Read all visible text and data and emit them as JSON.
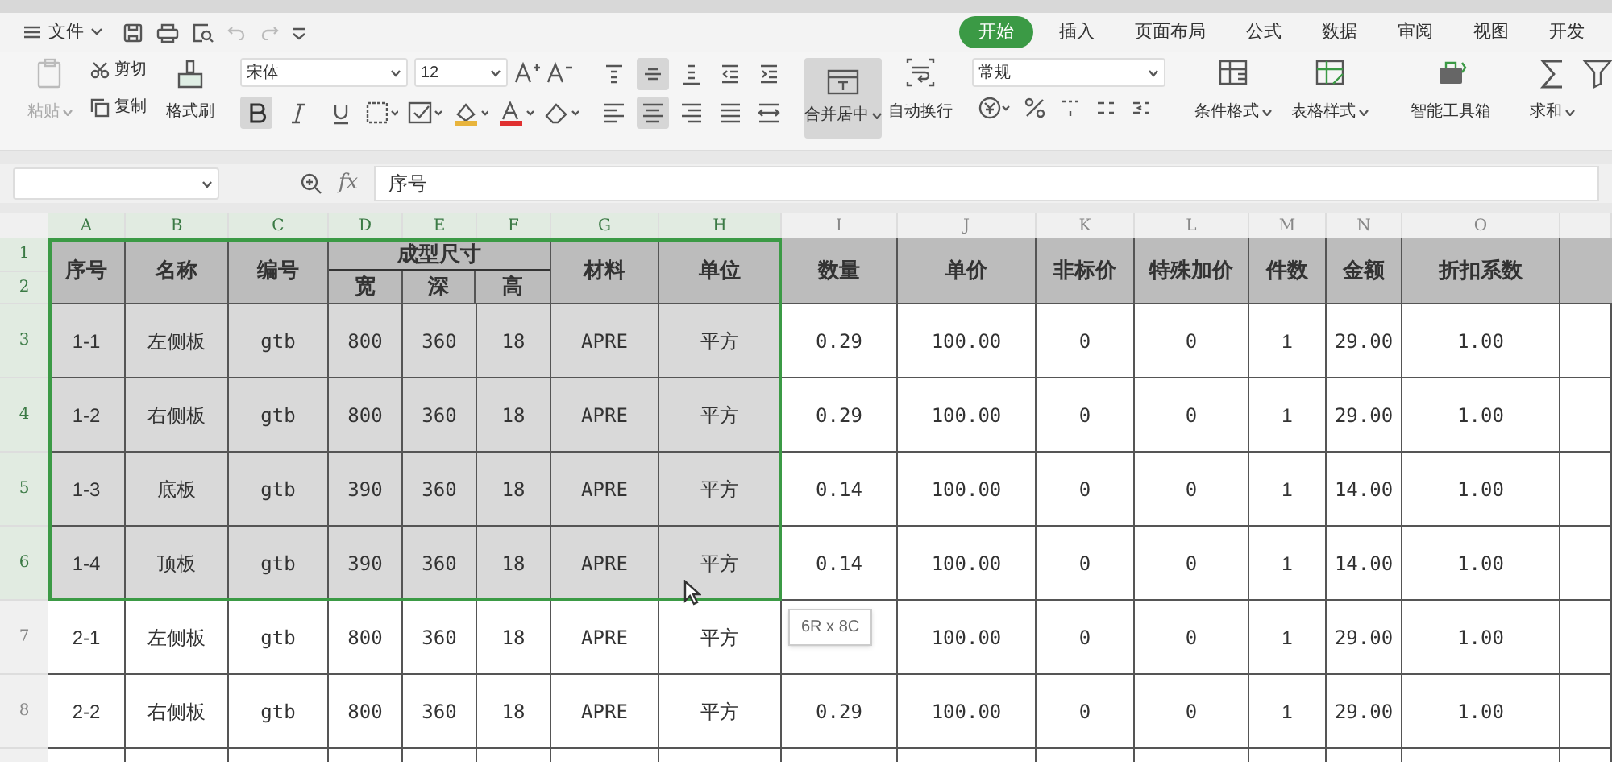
{
  "menu": {
    "label": "文件"
  },
  "ribbon_tabs": [
    {
      "label": "开始",
      "selected": true
    },
    {
      "label": "插入",
      "selected": false
    },
    {
      "label": "页面布局",
      "selected": false
    },
    {
      "label": "公式",
      "selected": false
    },
    {
      "label": "数据",
      "selected": false
    },
    {
      "label": "审阅",
      "selected": false
    },
    {
      "label": "视图",
      "selected": false
    },
    {
      "label": "开发",
      "selected": false
    }
  ],
  "clipboard": {
    "paste": "粘贴",
    "cut": "剪切",
    "copy": "复制",
    "format_painter": "格式刷"
  },
  "font": {
    "family": "宋体",
    "size": "12"
  },
  "font_toggles": [
    {
      "kind": "bold",
      "on": true
    },
    {
      "kind": "italic",
      "on": false
    },
    {
      "kind": "underline",
      "on": false
    }
  ],
  "align_top": [
    {
      "kind": "top",
      "on": false
    },
    {
      "kind": "middle",
      "on": true
    },
    {
      "kind": "bottom",
      "on": false
    },
    {
      "kind": "outdent",
      "on": false
    },
    {
      "kind": "indent",
      "on": false
    }
  ],
  "align_bottom": [
    {
      "kind": "left",
      "on": false
    },
    {
      "kind": "center",
      "on": true
    },
    {
      "kind": "right",
      "on": false
    },
    {
      "kind": "justify",
      "on": false
    },
    {
      "kind": "distribute",
      "on": false
    }
  ],
  "merge": {
    "label": "合并居中",
    "on": true
  },
  "wrap": {
    "label": "自动换行"
  },
  "number_format": {
    "value": "常规"
  },
  "big_buttons": [
    {
      "kind": "conditional",
      "label": "条件格式"
    },
    {
      "kind": "table-style",
      "label": "表格样式"
    },
    {
      "kind": "toolbox",
      "label": "智能工具箱"
    },
    {
      "kind": "sum",
      "label": "求和"
    },
    {
      "kind": "filter"
    }
  ],
  "formula_bar": {
    "fx": "fx",
    "content": "序号"
  },
  "columns": [
    {
      "letter": "A",
      "selected": true
    },
    {
      "letter": "B",
      "selected": true
    },
    {
      "letter": "C",
      "selected": true
    },
    {
      "letter": "D",
      "selected": true
    },
    {
      "letter": "E",
      "selected": true
    },
    {
      "letter": "F",
      "selected": true
    },
    {
      "letter": "G",
      "selected": true
    },
    {
      "letter": "H",
      "selected": true
    },
    {
      "letter": "I",
      "selected": false
    },
    {
      "letter": "J",
      "selected": false
    },
    {
      "letter": "K",
      "selected": false
    },
    {
      "letter": "L",
      "selected": false
    },
    {
      "letter": "M",
      "selected": false
    },
    {
      "letter": "N",
      "selected": false
    },
    {
      "letter": "O",
      "selected": false
    }
  ],
  "header": {
    "row_numbers": [
      {
        "number": "1",
        "selected": true
      },
      {
        "number": "2",
        "selected": true
      }
    ],
    "labels": [
      "序号",
      "名称",
      "编号",
      "成型尺寸",
      "材料",
      "单位",
      "数量",
      "单价",
      "非标价",
      "特殊加价",
      "件数",
      "金额",
      "折扣系数"
    ],
    "sub_labels": [
      "宽",
      "深",
      "高"
    ]
  },
  "rows": [
    {
      "number": "3",
      "selected": true,
      "cells": [
        "1-1",
        "左侧板",
        "gtb",
        "800",
        "360",
        "18",
        "APRE",
        "平方",
        "0.29",
        "100.00",
        "0",
        "0",
        "1",
        "29.00",
        "1.00"
      ]
    },
    {
      "number": "4",
      "selected": true,
      "cells": [
        "1-2",
        "右侧板",
        "gtb",
        "800",
        "360",
        "18",
        "APRE",
        "平方",
        "0.29",
        "100.00",
        "0",
        "0",
        "1",
        "29.00",
        "1.00"
      ]
    },
    {
      "number": "5",
      "selected": true,
      "cells": [
        "1-3",
        "底板",
        "gtb",
        "390",
        "360",
        "18",
        "APRE",
        "平方",
        "0.14",
        "100.00",
        "0",
        "0",
        "1",
        "14.00",
        "1.00"
      ]
    },
    {
      "number": "6",
      "selected": true,
      "cells": [
        "1-4",
        "顶板",
        "gtb",
        "390",
        "360",
        "18",
        "APRE",
        "平方",
        "0.14",
        "100.00",
        "0",
        "0",
        "1",
        "14.00",
        "1.00"
      ]
    },
    {
      "number": "7",
      "selected": false,
      "cells": [
        "2-1",
        "左侧板",
        "gtb",
        "800",
        "360",
        "18",
        "APRE",
        "平方",
        null,
        "100.00",
        "0",
        "0",
        "1",
        "29.00",
        "1.00"
      ]
    },
    {
      "number": "8",
      "selected": false,
      "cells": [
        "2-2",
        "右侧板",
        "gtb",
        "800",
        "360",
        "18",
        "APRE",
        "平方",
        "0.29",
        "100.00",
        "0",
        "0",
        "1",
        "29.00",
        "1.00"
      ]
    }
  ],
  "tooltip": "6R x 8C"
}
